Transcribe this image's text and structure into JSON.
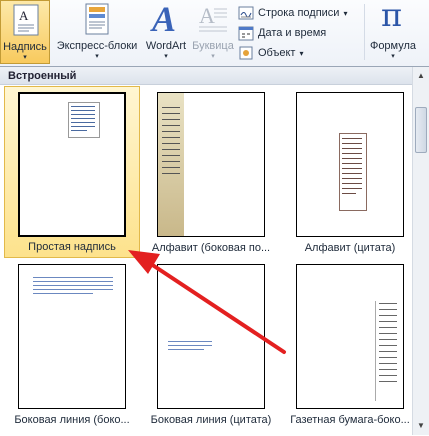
{
  "ribbon": {
    "textbox_label": "Надпись",
    "express_label": "Экспресс-блоки",
    "wordart_label": "WordArt",
    "dropcap_label": "Буквица",
    "signature_label": "Строка подписи",
    "datetime_label": "Дата и время",
    "object_label": "Объект",
    "formula_label": "Формула",
    "dropdown_glyph": "▾",
    "pi_glyph": "π",
    "wordart_glyph": "A"
  },
  "gallery": {
    "section_title": "Встроенный",
    "items": [
      {
        "label": "Простая надпись"
      },
      {
        "label": "Алфавит (боковая по..."
      },
      {
        "label": "Алфавит (цитата)"
      },
      {
        "label": "Боковая линия (боко..."
      },
      {
        "label": "Боковая линия (цитата)"
      },
      {
        "label": "Газетная бумага-боко..."
      }
    ]
  },
  "scrollbar": {
    "up_glyph": "▲",
    "down_glyph": "▼"
  },
  "colors": {
    "accent": "#f8ca5e",
    "arrow": "#e32020"
  }
}
